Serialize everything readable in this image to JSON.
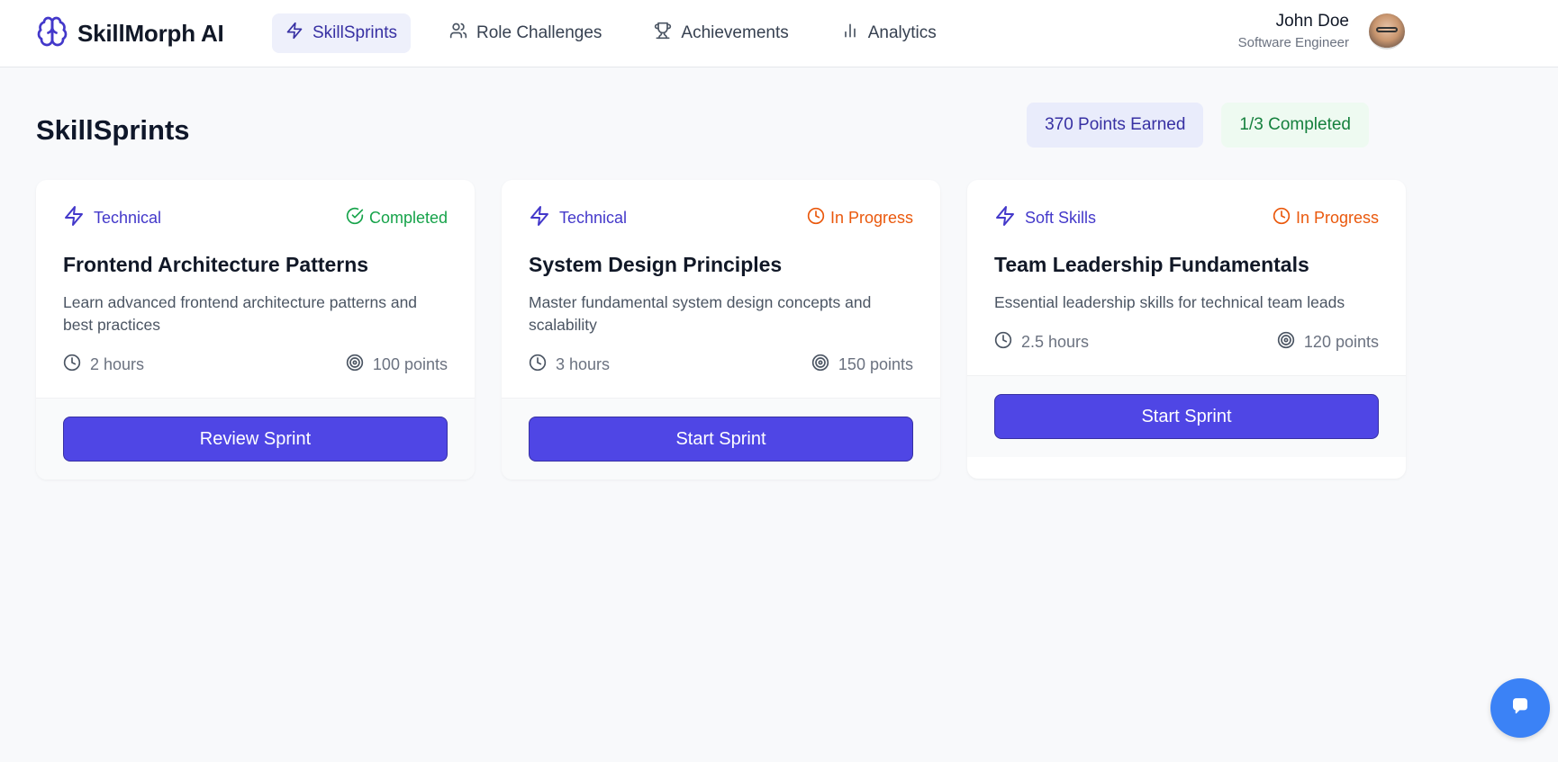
{
  "app": {
    "name": "SkillMorph AI"
  },
  "nav": {
    "items": [
      {
        "label": "SkillSprints",
        "icon": "lightning-icon",
        "active": true
      },
      {
        "label": "Role Challenges",
        "icon": "users-icon"
      },
      {
        "label": "Achievements",
        "icon": "trophy-icon"
      },
      {
        "label": "Analytics",
        "icon": "bar-chart-icon"
      }
    ]
  },
  "user": {
    "name": "John Doe",
    "role": "Software Engineer"
  },
  "page": {
    "title": "SkillSprints",
    "points_badge": "370 Points Earned",
    "completed_badge": "1/3 Completed"
  },
  "cards": [
    {
      "category": "Technical",
      "status": "Completed",
      "title": "Frontend Architecture Patterns",
      "description": "Learn advanced frontend architecture patterns and best practices",
      "duration": "2 hours",
      "points": "100 points",
      "button": "Review Sprint"
    },
    {
      "category": "Technical",
      "status": "In Progress",
      "title": "System Design Principles",
      "description": "Master fundamental system design concepts and scalability",
      "duration": "3 hours",
      "points": "150 points",
      "button": "Start Sprint"
    },
    {
      "category": "Soft Skills",
      "status": "In Progress",
      "title": "Team Leadership Fundamentals",
      "description": "Essential leadership skills for technical team leads",
      "duration": "2.5 hours",
      "points": "120 points",
      "button": "Start Sprint"
    }
  ],
  "colors": {
    "accent": "#4f46e5",
    "completed": "#16a34a",
    "in_progress": "#ea580c",
    "chat_button": "#3b82f6"
  }
}
